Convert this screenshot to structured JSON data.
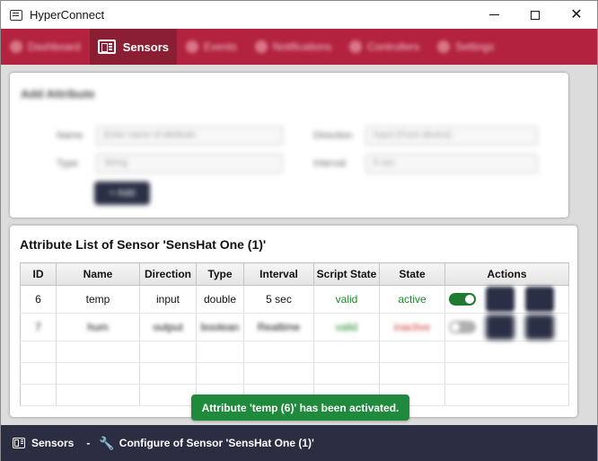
{
  "window": {
    "title": "HyperConnect",
    "controls": {
      "minimize": "minimize-icon",
      "maximize": "maximize-icon",
      "close": "close-icon"
    }
  },
  "nav": {
    "items": [
      {
        "label": "Dashboard",
        "active": false
      },
      {
        "label": "Sensors",
        "active": true
      },
      {
        "label": "Events",
        "active": false
      },
      {
        "label": "Notifications",
        "active": false
      },
      {
        "label": "Controllers",
        "active": false
      },
      {
        "label": "Settings",
        "active": false
      }
    ]
  },
  "add_form": {
    "heading": "Add Attribute",
    "name_label": "Name",
    "name_placeholder": "Enter name of attribute",
    "type_label": "Type",
    "type_value": "String",
    "direction_label": "Direction",
    "direction_value": "Input (From device)",
    "interval_label": "Interval",
    "interval_value": "5 sec",
    "add_button": "+ Add"
  },
  "attribute_list": {
    "title": "Attribute List of Sensor 'SensHat One (1)'",
    "columns": [
      "ID",
      "Name",
      "Direction",
      "Type",
      "Interval",
      "Script State",
      "State",
      "Actions"
    ],
    "rows": [
      {
        "id": "6",
        "name": "temp",
        "direction": "input",
        "type": "double",
        "interval": "5 sec",
        "script_state": "valid",
        "state": "active",
        "enabled": true
      },
      {
        "id": "7",
        "name": "hum",
        "direction": "output",
        "type": "boolean",
        "interval": "Realtime",
        "script_state": "valid",
        "state": "inactive",
        "enabled": false
      }
    ]
  },
  "toast": {
    "message": "Attribute 'temp (6)' has been activated."
  },
  "statusbar": {
    "section": "Sensors",
    "separator": "-",
    "page": "Configure of Sensor 'SensHat One (1)'"
  },
  "colors": {
    "nav": "#b3233f",
    "nav_active": "#8b1e33",
    "toast": "#1f8a3b",
    "statusbar": "#2b2d42",
    "dark_button": "#2b2f45"
  }
}
